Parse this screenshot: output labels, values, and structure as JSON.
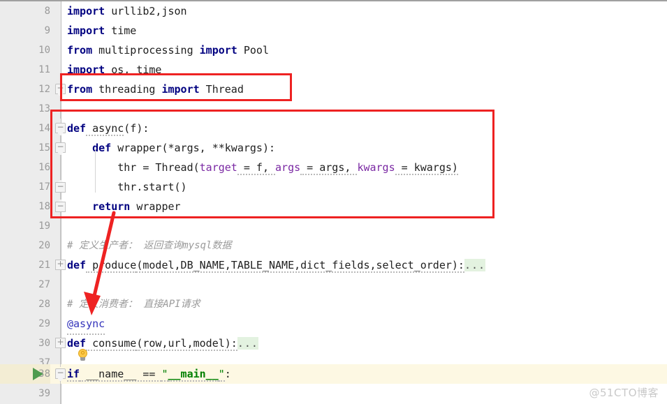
{
  "editor": {
    "language": "Python",
    "watermark": "@51CTO博客",
    "colors": {
      "keyword": "#000080",
      "comment": "#9b9b9b",
      "string": "#008000",
      "kwarg": "#7a28a3",
      "decorator": "#3333bb",
      "annotation_red": "#ee2222",
      "highlight_line_bg": "#fdf8e3",
      "fold_placeholder_bg": "#e3f2e0",
      "gutter_bg": "#ececec",
      "line_number": "#9a9a9a"
    },
    "lines": [
      {
        "n": "8",
        "text": "import urllib2,json"
      },
      {
        "n": "9",
        "text": "import time"
      },
      {
        "n": "10",
        "text": "from multiprocessing import Pool"
      },
      {
        "n": "11",
        "text": "import os, time"
      },
      {
        "n": "12",
        "text": "from threading import Thread"
      },
      {
        "n": "13",
        "text": ""
      },
      {
        "n": "14",
        "text": "def async(f):"
      },
      {
        "n": "15",
        "text": "    def wrapper(*args, **kwargs):"
      },
      {
        "n": "16",
        "text": "        thr = Thread(target = f, args = args, kwargs = kwargs)"
      },
      {
        "n": "17",
        "text": "        thr.start()"
      },
      {
        "n": "18",
        "text": "    return wrapper"
      },
      {
        "n": "19",
        "text": ""
      },
      {
        "n": "20",
        "text": "# 定义生产者： 返回查询mysql数据"
      },
      {
        "n": "21",
        "text": "def produce(model,DB_NAME,TABLE_NAME,dict_fields,select_order):..."
      },
      {
        "n": "27",
        "text": ""
      },
      {
        "n": "28",
        "text": "# 定义消费者： 直接API请求"
      },
      {
        "n": "29",
        "text": "@async"
      },
      {
        "n": "30",
        "text": "def consume(row,url,model):..."
      },
      {
        "n": "37",
        "text": ""
      },
      {
        "n": "38",
        "text": "if __name__ == \"__main__\":"
      },
      {
        "n": "39",
        "text": ""
      }
    ],
    "tokens": {
      "l8": {
        "kw": "import",
        "rest": " urllib2,json"
      },
      "l9": {
        "kw": "import",
        "rest": " time"
      },
      "l10": {
        "kw1": "from",
        "mid": " multiprocessing ",
        "kw2": "import",
        "rest": " Pool"
      },
      "l11": {
        "kw": "import",
        "rest": " os, time"
      },
      "l12": {
        "kw1": "from",
        "mid": " threading ",
        "kw2": "import",
        "rest": " Thread"
      },
      "l14": {
        "kw": "def",
        "name": " async",
        "rest": "(f):"
      },
      "l15": {
        "indent": "    ",
        "kw": "def",
        "name": " wrapper",
        "rest": "(*args, **kwargs):"
      },
      "l16": {
        "indent": "        ",
        "head": "thr = Thread(",
        "kwarg1": "target",
        "eq1": " = f, ",
        "kwarg2": "args",
        "eq2": " = args, ",
        "kwarg3": "kwargs",
        "eq3": " = kwargs)"
      },
      "l17": {
        "indent": "        ",
        "rest": "thr.start()"
      },
      "l18": {
        "indent": "    ",
        "kw": "return",
        "rest": " wrapper"
      },
      "l20": {
        "comment": "# 定义生产者： 返回查询mysql数据"
      },
      "l21": {
        "kw": "def",
        "name": " produce",
        "rest": "(model,DB_NAME,TABLE_NAME,dict_fields,select_order):",
        "ellipsis": "..."
      },
      "l28": {
        "comment": "# 定义消费者： 直接API请求"
      },
      "l29": {
        "decorator": "@async"
      },
      "l30": {
        "kw": "def",
        "name": " consume",
        "rest": "(row,url,model):",
        "ellipsis": "..."
      },
      "l38": {
        "kw": "if",
        "mid": " __name__ == ",
        "quote_open": "\"",
        "str": "__main__",
        "quote_close": "\"",
        "rest": ":"
      }
    },
    "gutter": {
      "run_marker_line": "38",
      "lightbulb_line": "37",
      "fold_collapsed_lines": [
        "12",
        "21",
        "30"
      ],
      "fold_expanded_lines": [
        "14",
        "15",
        "17",
        "18",
        "38"
      ]
    },
    "annotations": {
      "box_1_label": "highlight-from-threading-import-thread",
      "box_2_label": "highlight-async-decorator-definition",
      "arrow_label": "arrow-pointing-to-async-decorator-usage"
    }
  }
}
